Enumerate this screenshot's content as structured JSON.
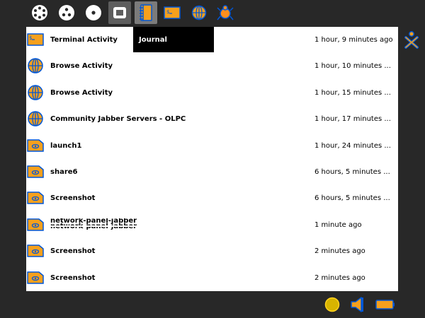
{
  "topbar": {
    "items": [
      {
        "name": "zoom-neighborhood-icon"
      },
      {
        "name": "zoom-group-icon"
      },
      {
        "name": "zoom-home-icon"
      },
      {
        "name": "zoom-activity-icon"
      },
      {
        "name": "journal-icon"
      },
      {
        "name": "terminal-activity-icon"
      },
      {
        "name": "browse-activity-icon"
      },
      {
        "name": "xo-buddy-icon"
      }
    ],
    "tooltip": "Journal"
  },
  "colors": {
    "background": "#282828",
    "accent_blue": "#0057d8",
    "accent_orange": "#f6a01d",
    "sugar_fill": "#ff8f1e"
  },
  "journal": {
    "entries": [
      {
        "icon": "terminal-icon",
        "title": "Terminal Activity",
        "date": "1 hour, 9 minutes ago"
      },
      {
        "icon": "browse-globe-icon",
        "title": "Browse Activity",
        "date": "1 hour, 10 minutes ..."
      },
      {
        "icon": "browse-globe-icon",
        "title": "Browse Activity",
        "date": "1 hour, 15 minutes ..."
      },
      {
        "icon": "browse-globe-icon",
        "title": "Community Jabber Servers - OLPC",
        "date": "1 hour, 17 minutes ..."
      },
      {
        "icon": "document-icon",
        "title": "launch1",
        "date": "1 hour, 24 minutes ..."
      },
      {
        "icon": "document-icon",
        "title": "share6",
        "date": "6 hours, 5 minutes ..."
      },
      {
        "icon": "document-icon",
        "title": "Screenshot",
        "date": "6 hours, 5 minutes ..."
      },
      {
        "icon": "document-icon",
        "title": "network-panel-jabber",
        "date": "1 minute ago"
      },
      {
        "icon": "document-icon",
        "title": "Screenshot",
        "date": "2 minutes ago"
      },
      {
        "icon": "document-icon",
        "title": "Screenshot",
        "date": "2 minutes ago"
      }
    ]
  },
  "tray": [
    {
      "name": "network-indicator-icon"
    },
    {
      "name": "volume-speaker-icon"
    },
    {
      "name": "battery-icon"
    }
  ]
}
